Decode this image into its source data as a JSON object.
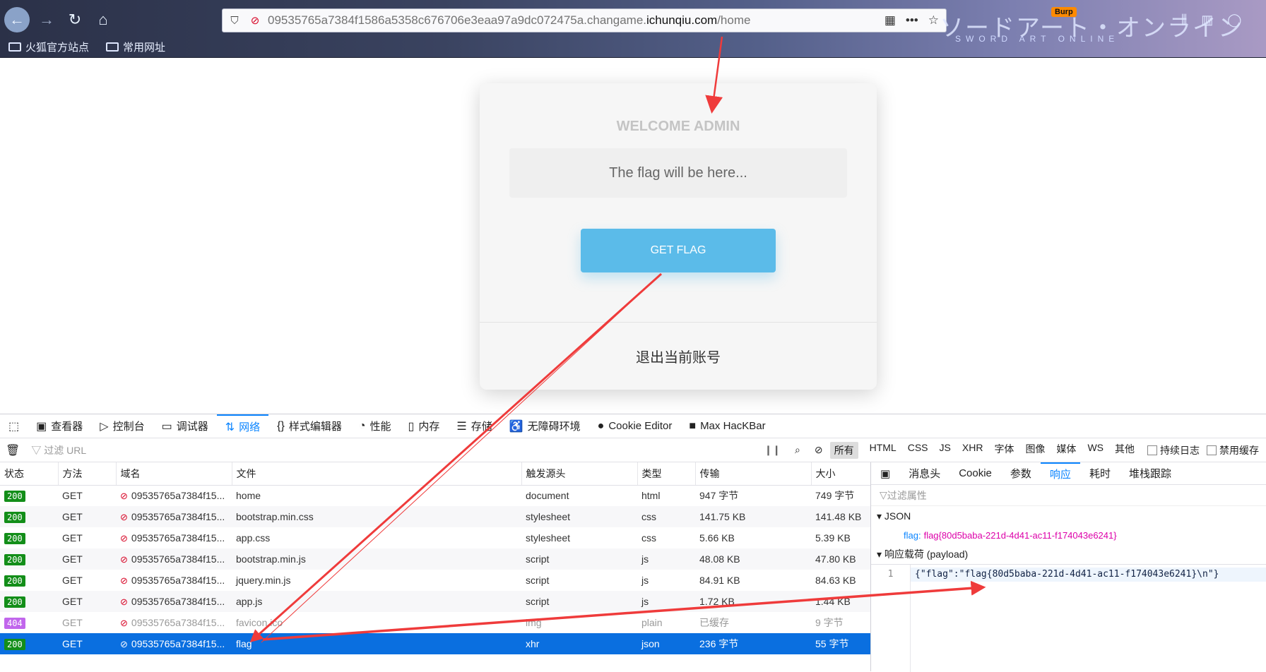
{
  "browser": {
    "url_prefix": "09535765a7384f1586a5358c676706e3eaa97a9dc072475a.changame.",
    "url_host": "ichunqiu.com",
    "url_path": "/home",
    "bookmarks": [
      "火狐官方站点",
      "常用网址"
    ],
    "theme_title": "ソードアート・オンライン",
    "theme_subtitle": "SWORD ART ONLINE",
    "burp_label": "Burp"
  },
  "page": {
    "welcome": "WELCOME ADMIN",
    "flag_placeholder": "The flag will be here...",
    "get_flag_label": "GET FLAG",
    "logout_label": "退出当前账号"
  },
  "devtools": {
    "tabs": [
      {
        "label": "查看器",
        "icon": "inspector-icon"
      },
      {
        "label": "控制台",
        "icon": "console-icon"
      },
      {
        "label": "调试器",
        "icon": "debugger-icon"
      },
      {
        "label": "网络",
        "icon": "network-icon"
      },
      {
        "label": "样式编辑器",
        "icon": "style-editor-icon"
      },
      {
        "label": "性能",
        "icon": "performance-icon"
      },
      {
        "label": "内存",
        "icon": "memory-icon"
      },
      {
        "label": "存储",
        "icon": "storage-icon"
      },
      {
        "label": "无障碍环境",
        "icon": "accessibility-icon"
      },
      {
        "label": "Cookie Editor",
        "icon": "cookie-icon"
      },
      {
        "label": "Max HacKBar",
        "icon": "hackbar-icon"
      }
    ],
    "filter_placeholder": "过滤 URL",
    "type_filters": [
      "所有",
      "HTML",
      "CSS",
      "JS",
      "XHR",
      "字体",
      "图像",
      "媒体",
      "WS",
      "其他"
    ],
    "persist_logs": "持续日志",
    "disable_cache": "禁用缓存",
    "columns": [
      "状态",
      "方法",
      "域名",
      "文件",
      "触发源头",
      "类型",
      "传输",
      "大小"
    ],
    "rows": [
      {
        "status": "200",
        "method": "GET",
        "domain": "09535765a7384f15...",
        "file": "home",
        "cause": "document",
        "type": "html",
        "transferred": "947 字节",
        "size": "749 字节"
      },
      {
        "status": "200",
        "method": "GET",
        "domain": "09535765a7384f15...",
        "file": "bootstrap.min.css",
        "cause": "stylesheet",
        "type": "css",
        "transferred": "141.75 KB",
        "size": "141.48 KB"
      },
      {
        "status": "200",
        "method": "GET",
        "domain": "09535765a7384f15...",
        "file": "app.css",
        "cause": "stylesheet",
        "type": "css",
        "transferred": "5.66 KB",
        "size": "5.39 KB"
      },
      {
        "status": "200",
        "method": "GET",
        "domain": "09535765a7384f15...",
        "file": "bootstrap.min.js",
        "cause": "script",
        "type": "js",
        "transferred": "48.08 KB",
        "size": "47.80 KB"
      },
      {
        "status": "200",
        "method": "GET",
        "domain": "09535765a7384f15...",
        "file": "jquery.min.js",
        "cause": "script",
        "type": "js",
        "transferred": "84.91 KB",
        "size": "84.63 KB"
      },
      {
        "status": "200",
        "method": "GET",
        "domain": "09535765a7384f15...",
        "file": "app.js",
        "cause": "script",
        "type": "js",
        "transferred": "1.72 KB",
        "size": "1.44 KB"
      },
      {
        "status": "404",
        "method": "GET",
        "domain": "09535765a7384f15...",
        "file": "favicon.ico",
        "cause": "img",
        "type": "plain",
        "transferred": "已缓存",
        "size": "9 字节"
      },
      {
        "status": "200",
        "method": "GET",
        "domain": "09535765a7384f15...",
        "file": "flag",
        "cause": "xhr",
        "type": "json",
        "transferred": "236 字节",
        "size": "55 字节"
      }
    ],
    "side_tabs": [
      "消息头",
      "Cookie",
      "参数",
      "响应",
      "耗时",
      "堆栈跟踪"
    ],
    "side_filter": "过滤属性",
    "json_section": "JSON",
    "json_key": "flag:",
    "json_value": "flag{80d5baba-221d-4d41-ac11-f174043e6241}",
    "payload_section": "响应载荷 (payload)",
    "line_number": "1",
    "payload_text": "{\"flag\":\"flag{80d5baba-221d-4d41-ac11-f174043e6241}\\n\"}"
  },
  "colors": {
    "accent": "#0a84ff",
    "get_flag_button": "#5bbbe9",
    "status_200": "#138e19",
    "status_404": "#c166ec",
    "annotation_arrow": "#ef3b3b"
  }
}
